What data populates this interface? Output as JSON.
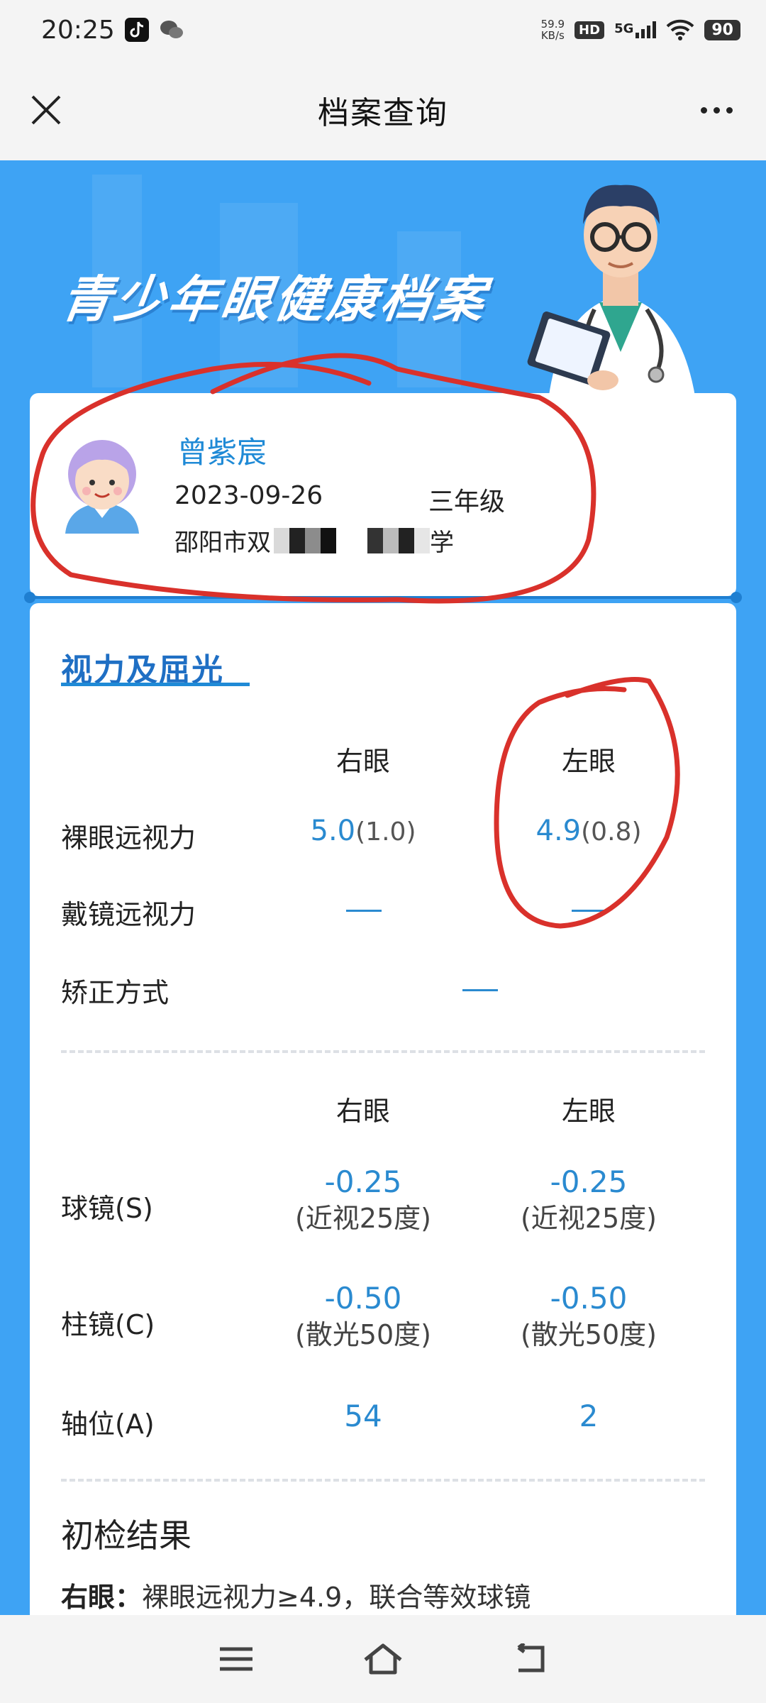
{
  "status_bar": {
    "time": "20:25",
    "net_speed_value": "59.9",
    "net_speed_unit": "KB/s",
    "hd": "HD",
    "network": "5G",
    "battery": "90",
    "icons": [
      "douyin-icon",
      "wechat-icon",
      "wifi-icon",
      "signal-icon"
    ]
  },
  "title_bar": {
    "title": "档案查询",
    "close_icon": "close-icon",
    "more_icon": "more-dots-icon"
  },
  "banner": {
    "title": "青少年眼健康档案",
    "illustration": "doctor-illustration"
  },
  "profile": {
    "name": "曾紫宸",
    "date": "2023-09-26",
    "grade": "三年级",
    "school_prefix": "邵阳市双",
    "school_suffix": "学"
  },
  "vision": {
    "section_title": "视力及屈光",
    "headers": {
      "right_eye": "右眼",
      "left_eye": "左眼"
    },
    "rows": {
      "naked": {
        "label": "裸眼远视力",
        "right_main": "5.0",
        "right_sub": "(1.0)",
        "left_main": "4.9",
        "left_sub": "(0.8)"
      },
      "glasses": {
        "label": "戴镜远视力"
      },
      "correction": {
        "label": "矫正方式"
      }
    }
  },
  "refraction": {
    "headers": {
      "right_eye": "右眼",
      "left_eye": "左眼"
    },
    "sphere": {
      "label": "球镜(S)",
      "right_main": "-0.25",
      "right_sub": "(近视25度)",
      "left_main": "-0.25",
      "left_sub": "(近视25度)"
    },
    "cylinder": {
      "label": "柱镜(C)",
      "right_main": "-0.50",
      "right_sub": "(散光50度)",
      "left_main": "-0.50",
      "left_sub": "(散光50度)"
    },
    "axis": {
      "label": "轴位(A)",
      "right": "54",
      "left": "2"
    }
  },
  "result": {
    "title": "初检结果",
    "right_label": "右眼：",
    "right_text": "裸眼远视力≥4.9，联合等效球镜"
  },
  "colors": {
    "accent": "#2a8ad0",
    "banner": "#3ea3f4",
    "annotation": "#d9312b"
  }
}
